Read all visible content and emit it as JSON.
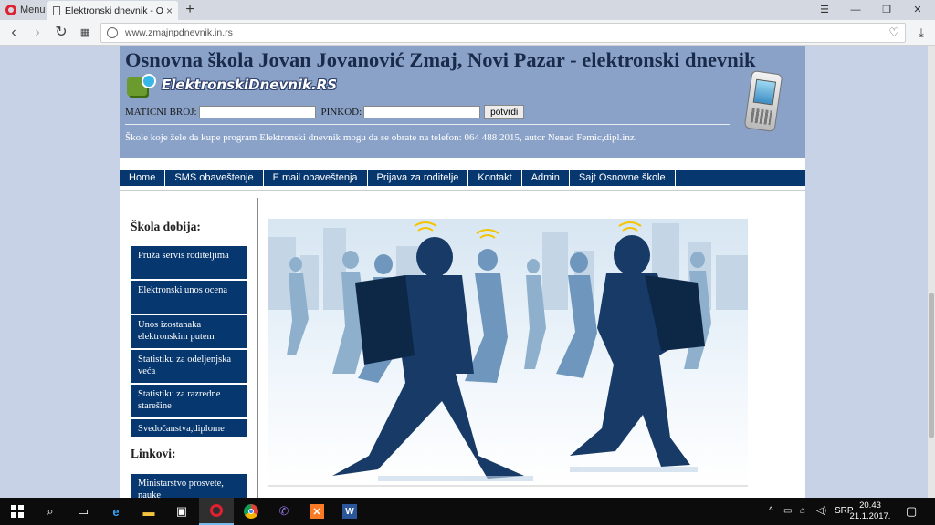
{
  "browser": {
    "menu_label": "Menu",
    "tab_title": "Elektronski dnevnik - Osnovna",
    "tab_close": "×",
    "new_tab": "+",
    "url": "www.zmajnpdnevnik.in.rs"
  },
  "site": {
    "title": "Osnovna škola Jovan Jovanović Zmaj, Novi Pazar - elektronski dnevnik",
    "logo_text": "ElektronskiDnevnik.RS",
    "maticni_label": "MATICNI BROJ:",
    "pinkod_label": "PINKOD:",
    "submit_label": "potvrdi",
    "info_text": "Škole koje žele da kupe program Elektronski dnevnik mogu da se obrate na telefon: 064 488 2015, autor Nenad Femic,dipl.inz."
  },
  "menu": [
    "Home",
    "SMS obaveštenje",
    "E mail obaveštenja",
    "Prijava za roditelje",
    "Kontakt",
    "Admin",
    "Sajt Osnovne škole"
  ],
  "sidebar": {
    "heading_school": "Škola dobija:",
    "items": [
      "Pruža servis roditeljima",
      "Elektronski unos ocena",
      "Unos izostanaka elektronskim putem",
      "Statistiku za odeljenjska veća",
      "Statistiku za razredne starešine",
      "Svedočanstva,diplome"
    ],
    "heading_links": "Linkovi:",
    "links": [
      "Ministarstvo prosvete, nauke"
    ]
  },
  "taskbar": {
    "language": "SRP",
    "time": "20.43",
    "date": "21.1.2017."
  }
}
